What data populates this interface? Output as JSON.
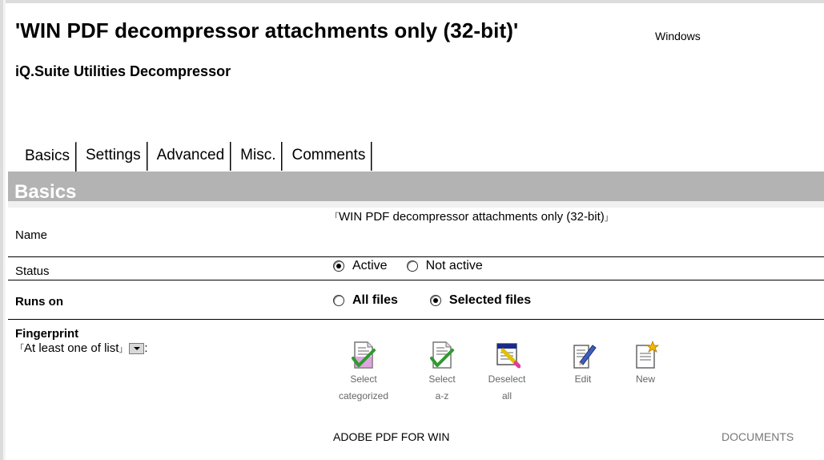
{
  "document": {
    "title": "'WIN PDF decompressor attachments only (32-bit)'",
    "platform": "Windows",
    "subtitle": "iQ.Suite Utilities Decompressor"
  },
  "tabs": [
    {
      "label": "Basics",
      "active": true
    },
    {
      "label": "Settings",
      "active": false
    },
    {
      "label": "Advanced",
      "active": false
    },
    {
      "label": "Misc.",
      "active": false
    },
    {
      "label": "Comments",
      "active": false
    }
  ],
  "section": {
    "title": "Basics"
  },
  "fields": {
    "name": {
      "label": "Name",
      "value": "WIN PDF decompressor attachments only (32-bit)"
    },
    "status": {
      "label": "Status",
      "options": [
        {
          "label": "Active",
          "selected": true
        },
        {
          "label": "Not active",
          "selected": false
        }
      ]
    },
    "runs_on": {
      "label": "Runs on",
      "options": [
        {
          "label": "All files",
          "selected": false
        },
        {
          "label": "Selected files",
          "selected": true
        }
      ]
    },
    "fingerprint": {
      "label": "Fingerprint",
      "mode_value": "At least one of list",
      "mode_suffix": ":"
    }
  },
  "actions": [
    {
      "icon": "select-categorized-icon",
      "label_line1": "Select",
      "label_line2": "categorized"
    },
    {
      "icon": "select-a-z-icon",
      "label_line1": "Select",
      "label_line2": "a-z"
    },
    {
      "icon": "deselect-all-icon",
      "label_line1": "Deselect",
      "label_line2": "all"
    },
    {
      "icon": "edit-icon",
      "label_line1": "Edit",
      "label_line2": ""
    },
    {
      "icon": "new-icon",
      "label_line1": "New",
      "label_line2": ""
    }
  ],
  "fingerprint_list": [
    {
      "name": "ADOBE PDF FOR WIN",
      "category": "DOCUMENTS"
    }
  ],
  "colors": {
    "section_bar": "#b3b3b3",
    "checkmark": "#2f9a2f",
    "inactive_text": "#666666"
  }
}
